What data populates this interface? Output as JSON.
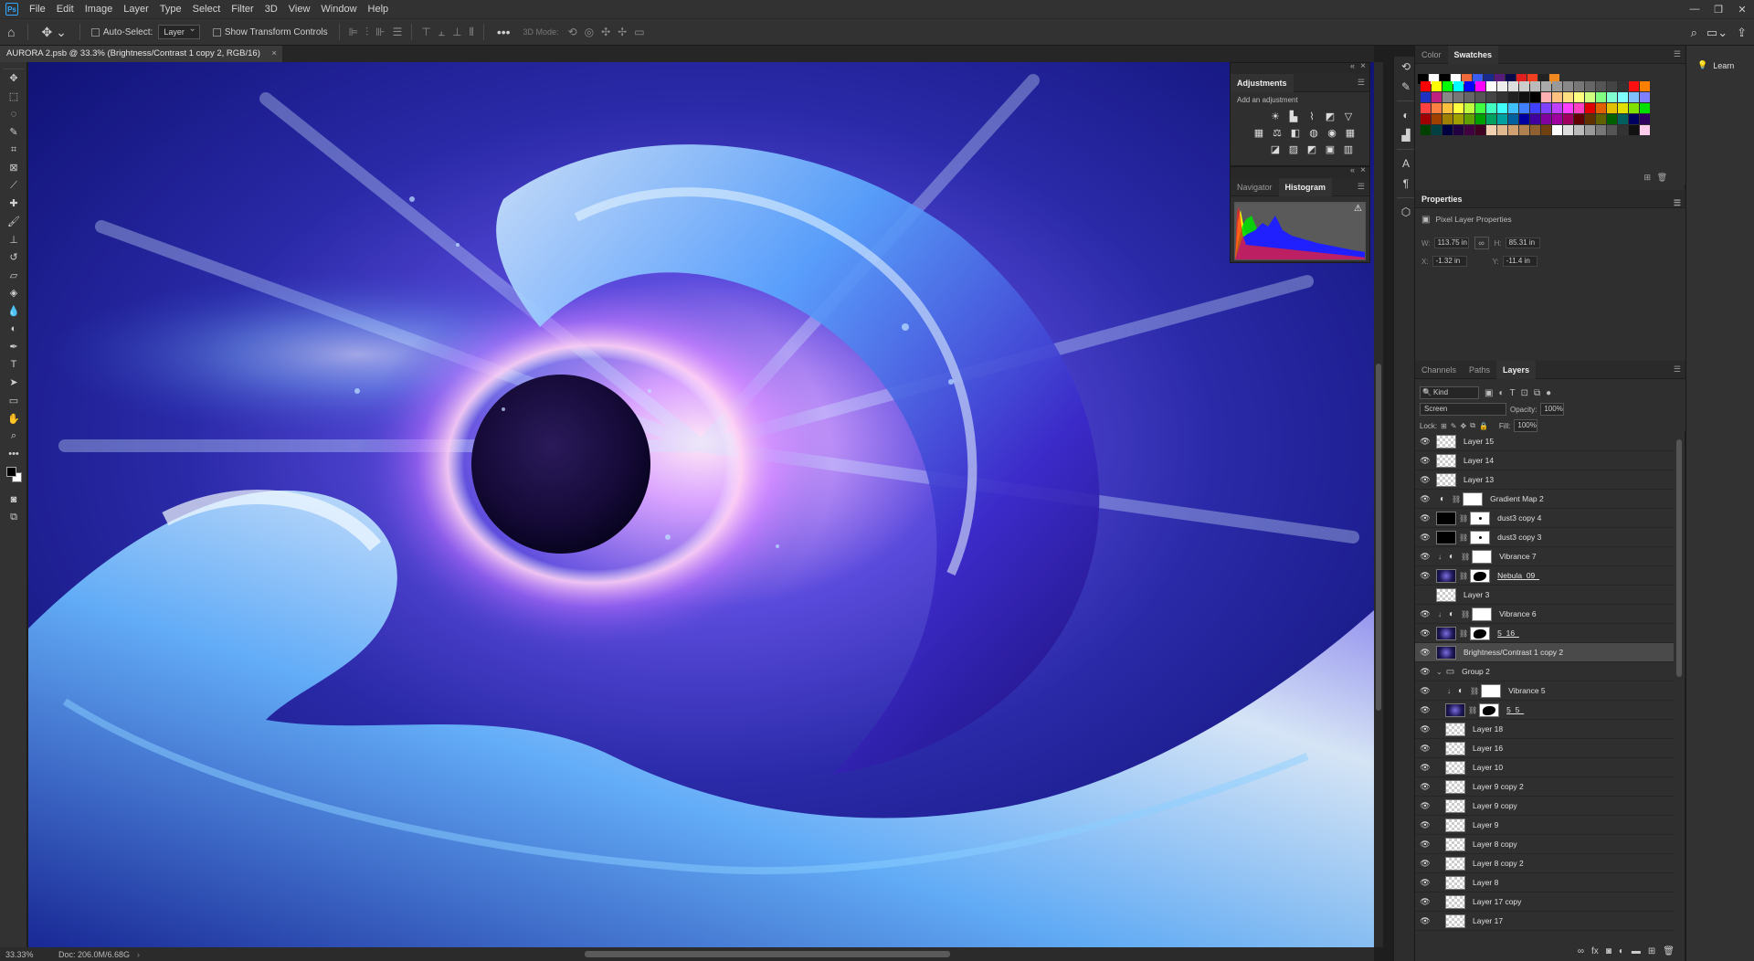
{
  "menu": [
    "File",
    "Edit",
    "Image",
    "Layer",
    "Type",
    "Select",
    "Filter",
    "3D",
    "View",
    "Window",
    "Help"
  ],
  "options": {
    "auto_select_label": "Auto-Select:",
    "auto_select_value": "Layer",
    "transform_label": "Show Transform Controls",
    "mode_3d": "3D Mode:"
  },
  "document_tab": "AURORA 2.psb @ 33.3% (Brightness/Contrast 1 copy 2, RGB/16)",
  "status": {
    "zoom": "33.33%",
    "doc": "Doc: 206.0M/6.68G"
  },
  "adjustments": {
    "title": "Adjustments",
    "subtitle": "Add an adjustment"
  },
  "nav_panel": {
    "tabs": [
      "Navigator",
      "Histogram"
    ],
    "active": "Histogram"
  },
  "swatch_panel": {
    "tabs": [
      "Color",
      "Swatches"
    ],
    "active": "Swatches"
  },
  "properties": {
    "title": "Properties",
    "kind": "Pixel Layer Properties",
    "w_label": "W:",
    "w": "113.75 in",
    "h_label": "H:",
    "h": "85.31 in",
    "x_label": "X:",
    "x": "-1.32 in",
    "y_label": "Y:",
    "y": "-11.4 in"
  },
  "layers_panel": {
    "tabs": [
      "Channels",
      "Paths",
      "Layers"
    ],
    "active": "Layers",
    "kind": "Kind",
    "blend_mode": "Screen",
    "opacity_label": "Opacity:",
    "opacity": "100%",
    "lock_label": "Lock:",
    "fill_label": "Fill:",
    "fill": "100%"
  },
  "layers": [
    {
      "name": "Layer 15",
      "type": "pixel"
    },
    {
      "name": "Layer 14",
      "type": "pixel"
    },
    {
      "name": "Layer 13",
      "type": "pixel"
    },
    {
      "name": "Gradient Map 2",
      "type": "adjustment"
    },
    {
      "name": "dust3 copy 4",
      "type": "masked-dot"
    },
    {
      "name": "dust3 copy 3",
      "type": "masked-dot"
    },
    {
      "name": "Vibrance 7",
      "type": "adjustment-clip"
    },
    {
      "name": "Nebula_09_",
      "type": "image-masked"
    },
    {
      "name": "Layer 3",
      "type": "pixel-hidden"
    },
    {
      "name": "Vibrance 6",
      "type": "adjustment-clip"
    },
    {
      "name": "5_16_",
      "type": "image-masked"
    },
    {
      "name": "Brightness/Contrast 1 copy 2",
      "type": "selected"
    },
    {
      "name": "Group 2",
      "type": "group"
    },
    {
      "name": "Vibrance 5",
      "type": "adjustment-clip-indent"
    },
    {
      "name": "5_5_",
      "type": "image-masked-indent"
    },
    {
      "name": "Layer 18",
      "type": "pixel-indent"
    },
    {
      "name": "Layer 16",
      "type": "pixel-indent"
    },
    {
      "name": "Layer 10",
      "type": "pixel-indent"
    },
    {
      "name": "Layer 9 copy 2",
      "type": "pixel-indent"
    },
    {
      "name": "Layer 9 copy",
      "type": "pixel-indent"
    },
    {
      "name": "Layer 9",
      "type": "pixel-indent"
    },
    {
      "name": "Layer 8 copy",
      "type": "pixel-indent"
    },
    {
      "name": "Layer 8 copy 2",
      "type": "pixel-indent"
    },
    {
      "name": "Layer 8",
      "type": "pixel-indent"
    },
    {
      "name": "Layer 17 copy",
      "type": "pixel-indent"
    },
    {
      "name": "Layer 17",
      "type": "pixel-indent"
    }
  ],
  "learn": "Learn",
  "colors": {
    "accent": "#31a8ff",
    "panel": "#2f2f2f",
    "selected_row": "#4a4a4a"
  }
}
